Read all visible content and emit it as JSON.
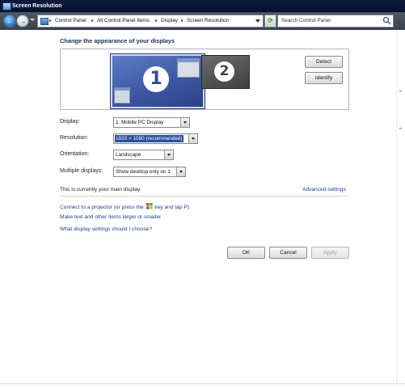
{
  "window": {
    "title": "Screen Resolution"
  },
  "address_bar": {
    "breadcrumbs": [
      "Control Panel",
      "All Control Panel Items",
      "Display",
      "Screen Resolution"
    ]
  },
  "search": {
    "placeholder": "Search Control Panel"
  },
  "main": {
    "heading": "Change the appearance of your displays",
    "monitors": [
      {
        "number": "1",
        "selected": true
      },
      {
        "number": "2",
        "selected": false
      }
    ],
    "detect_label": "Detect",
    "identify_label": "Identify",
    "fields": {
      "display": {
        "label": "Display:",
        "value": "1. Mobile PC Display"
      },
      "resolution": {
        "label": "Resolution:",
        "value": "1920 × 1080 (recommended)"
      },
      "orientation": {
        "label": "Orientation:",
        "value": "Landscape"
      },
      "multiple_displays": {
        "label": "Multiple displays:",
        "value": "Show desktop only on 1"
      }
    },
    "main_display_text": "This is currently your main display.",
    "advanced_link": "Advanced settings",
    "links": {
      "projector_before": "Connect to a projector (or press the",
      "projector_after": "key and tap P)",
      "text_size": "Make text and other items larger or smaller",
      "settings_help": "What display settings should I choose?"
    },
    "buttons": {
      "ok": "OK",
      "cancel": "Cancel",
      "apply": "Apply"
    }
  },
  "icons": {
    "window": "control-panel-icon",
    "back": "back-arrow-icon",
    "forward": "forward-arrow-icon",
    "refresh": "refresh-icon",
    "search": "search-icon",
    "windows_key": "windows-logo-icon"
  },
  "colors": {
    "titlebar": "#0a1a3e",
    "link": "#1a3f8c",
    "selected_monitor": "#3a559f",
    "selection_highlight": "#2b4f9a"
  }
}
